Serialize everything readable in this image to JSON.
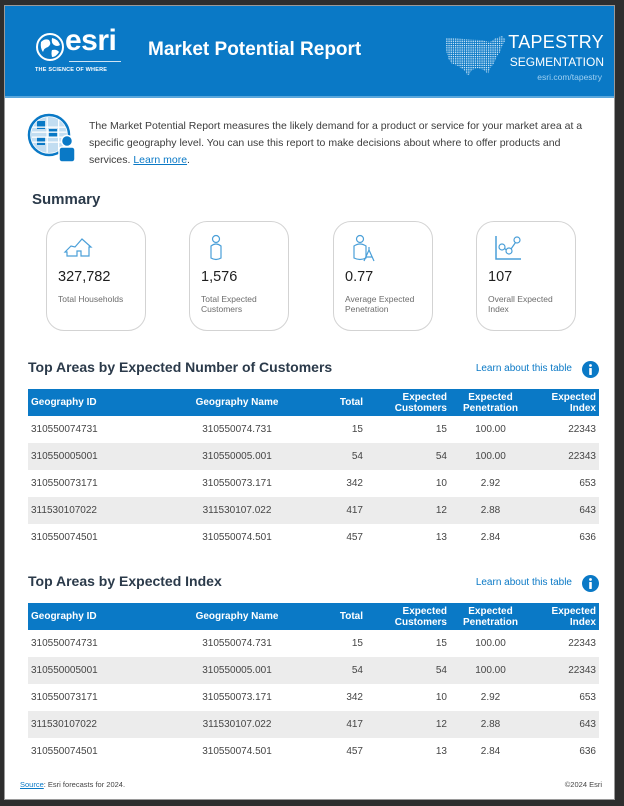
{
  "header": {
    "brand": "esri",
    "tagline": "THE SCIENCE OF WHERE",
    "title": "Market Potential Report",
    "tapestry_line1": "TAPESTRY",
    "tapestry_line2": "SEGMENTATION",
    "tapestry_url": "esri.com/tapestry"
  },
  "intro": {
    "text": "The Market Potential Report measures the likely demand for a product or service for your market area at a specific geography level. You can use this report to make decisions about where to offer products and services. ",
    "link": "Learn more",
    "suffix": "."
  },
  "summary": {
    "title": "Summary",
    "cards": [
      {
        "icon": "house-icon",
        "value": "327,782",
        "label": "Total Households"
      },
      {
        "icon": "person-icon",
        "value": "1,576",
        "label": "Total Expected Customers"
      },
      {
        "icon": "person-penetration-icon",
        "value": "0.77",
        "label": "Average Expected Penetration"
      },
      {
        "icon": "index-chart-icon",
        "value": "107",
        "label": "Overall Expected Index"
      }
    ]
  },
  "tables": [
    {
      "title": "Top Areas by Expected Number of Customers",
      "learn_link": "Learn about this table",
      "columns": [
        "Geography ID",
        "Geography Name",
        "Total",
        "Expected Customers",
        "Expected Penetration",
        "Expected Index"
      ],
      "rows": [
        [
          "310550074731",
          "310550074.731",
          "15",
          "15",
          "100.00",
          "22343"
        ],
        [
          "310550005001",
          "310550005.001",
          "54",
          "54",
          "100.00",
          "22343"
        ],
        [
          "310550073171",
          "310550073.171",
          "342",
          "10",
          "2.92",
          "653"
        ],
        [
          "311530107022",
          "311530107.022",
          "417",
          "12",
          "2.88",
          "643"
        ],
        [
          "310550074501",
          "310550074.501",
          "457",
          "13",
          "2.84",
          "636"
        ]
      ]
    },
    {
      "title": "Top Areas by Expected Index",
      "learn_link": "Learn about this table",
      "columns": [
        "Geography ID",
        "Geography Name",
        "Total",
        "Expected Customers",
        "Expected Penetration",
        "Expected Index"
      ],
      "rows": [
        [
          "310550074731",
          "310550074.731",
          "15",
          "15",
          "100.00",
          "22343"
        ],
        [
          "310550005001",
          "310550005.001",
          "54",
          "54",
          "100.00",
          "22343"
        ],
        [
          "310550073171",
          "310550073.171",
          "342",
          "10",
          "2.92",
          "653"
        ],
        [
          "311530107022",
          "311530107.022",
          "417",
          "12",
          "2.88",
          "643"
        ],
        [
          "310550074501",
          "310550074.501",
          "457",
          "13",
          "2.84",
          "636"
        ]
      ]
    }
  ],
  "footer": {
    "source_link": "Source",
    "source_text": ": Esri forecasts for 2024.",
    "copyright": "©2024 Esri"
  },
  "colors": {
    "brand_blue": "#0a79c6",
    "row_alt": "#ececec"
  }
}
